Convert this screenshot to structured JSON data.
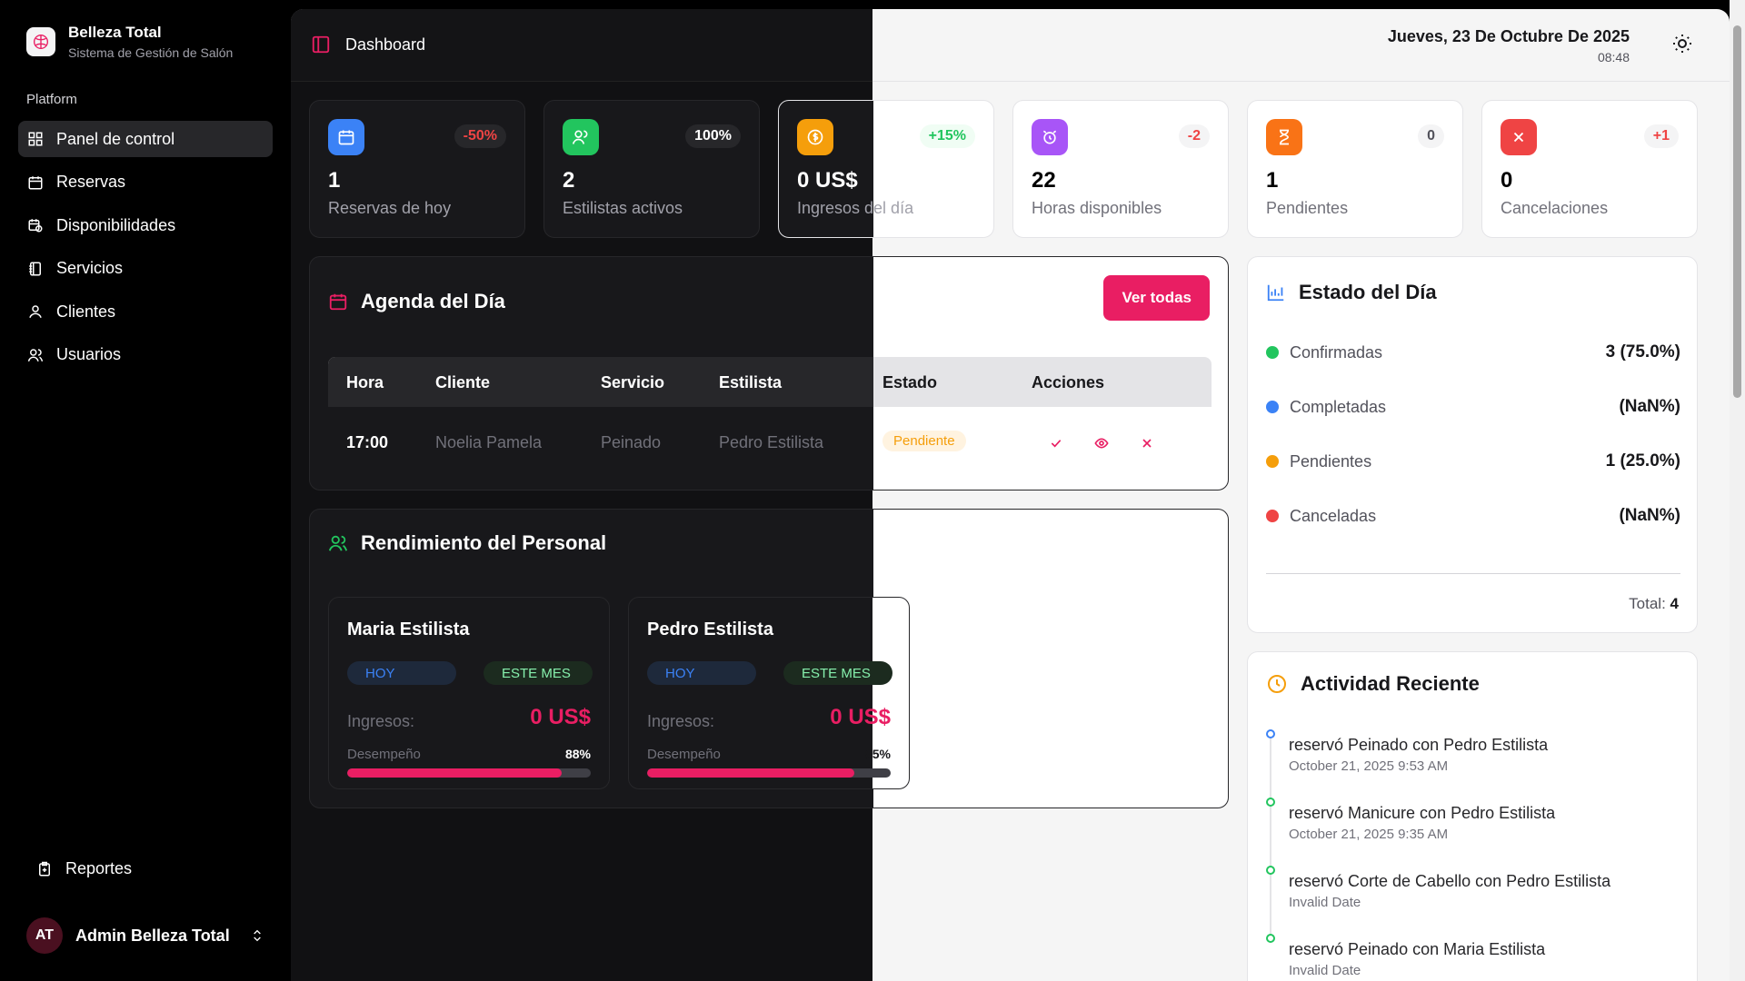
{
  "brand": {
    "name": "Belleza Total",
    "subtitle": "Sistema de Gestión de Salón"
  },
  "sidebar": {
    "section_label": "Platform",
    "items": [
      {
        "label": "Panel de control",
        "icon": "grid-icon",
        "active": true
      },
      {
        "label": "Reservas",
        "icon": "calendar-icon"
      },
      {
        "label": "Disponibilidades",
        "icon": "calendar-clock-icon"
      },
      {
        "label": "Servicios",
        "icon": "notebook-icon"
      },
      {
        "label": "Clientes",
        "icon": "user-icon"
      },
      {
        "label": "Usuarios",
        "icon": "users-icon"
      }
    ],
    "reports_label": "Reportes",
    "user": {
      "initials": "AT",
      "name": "Admin Belleza Total"
    }
  },
  "header": {
    "breadcrumb": "Dashboard",
    "date": "Jueves, 23 De Octubre De 2025",
    "time": "08:48"
  },
  "stats": [
    {
      "value": "1",
      "label": "Reservas de hoy",
      "badge": "-50%",
      "color": "#3b82f6",
      "badge_color": "#ef4444"
    },
    {
      "value": "2",
      "label": "Estilistas activos",
      "badge": "100%",
      "color": "#22c55e",
      "badge_color": "#ffffff"
    },
    {
      "value": "0 US$",
      "label": "Ingresos del día",
      "badge": "+15%",
      "color": "#f59e0b",
      "badge_color": "#22c55e"
    },
    {
      "value": "22",
      "label": "Horas disponibles",
      "badge": "-2",
      "color": "#a855f7",
      "badge_color": "#ef4444"
    },
    {
      "value": "1",
      "label": "Pendientes",
      "badge": "0",
      "color": "#f97316",
      "badge_color": "#52525b"
    },
    {
      "value": "0",
      "label": "Cancelaciones",
      "badge": "+1",
      "color": "#ef4444",
      "badge_color": "#ef4444"
    }
  ],
  "agenda": {
    "title": "Agenda del Día",
    "button": "Ver todas",
    "columns": [
      "Hora",
      "Cliente",
      "Servicio",
      "Estilista",
      "Estado",
      "Acciones"
    ],
    "rows": [
      {
        "hora": "17:00",
        "cliente": "Noelia Pamela",
        "servicio": "Peinado",
        "estilista": "Pedro Estilista",
        "estado": "Pendiente"
      }
    ]
  },
  "performance": {
    "title": "Rendimiento del Personal",
    "today_label": "HOY",
    "month_label": "ESTE MES",
    "income_label": "Ingresos:",
    "perf_label": "Desempeño",
    "staff": [
      {
        "name": "Maria Estilista",
        "income": "0 US$",
        "pct_text": "88%",
        "pct": 0.88
      },
      {
        "name": "Pedro Estilista",
        "income": "0 US$",
        "pct_text": "85%",
        "pct": 0.85
      }
    ]
  },
  "estado": {
    "title": "Estado del Día",
    "rows": [
      {
        "label": "Confirmadas",
        "value": "3 (75.0%)",
        "color": "#22c55e"
      },
      {
        "label": "Completadas",
        "value": "(NaN%)",
        "color": "#3b82f6"
      },
      {
        "label": "Pendientes",
        "value": "1 (25.0%)",
        "color": "#f59e0b"
      },
      {
        "label": "Canceladas",
        "value": "(NaN%)",
        "color": "#ef4444"
      }
    ],
    "total_label": "Total:",
    "total_value": "4"
  },
  "activity": {
    "title": "Actividad Reciente",
    "items": [
      {
        "text": "reservó Peinado con Pedro Estilista",
        "date": "October 21, 2025 9:53 AM",
        "color": "#3b82f6"
      },
      {
        "text": "reservó Manicure con Pedro Estilista",
        "date": "October 21, 2025 9:35 AM",
        "color": "#22c55e"
      },
      {
        "text": "reservó Corte de Cabello con Pedro Estilista",
        "date": "Invalid Date",
        "color": "#22c55e"
      },
      {
        "text": "reservó Peinado con Maria Estilista",
        "date": "Invalid Date",
        "color": "#22c55e"
      }
    ]
  },
  "colors": {
    "accent": "#e91e63"
  }
}
